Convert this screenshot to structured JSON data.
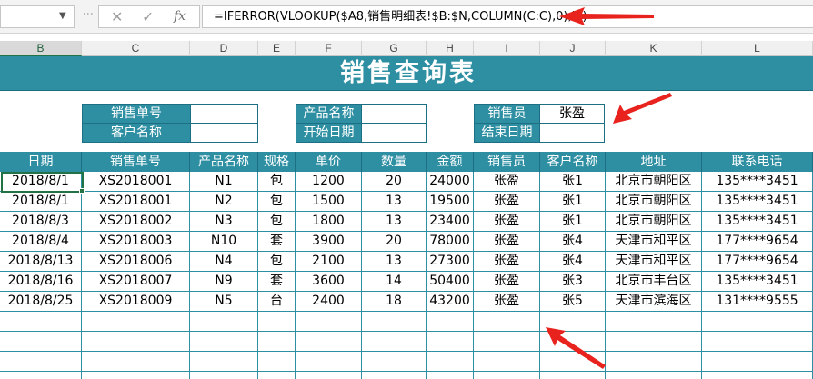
{
  "formula_bar": {
    "name_box": "",
    "cancel_symbol": "✕",
    "confirm_symbol": "✓",
    "fx_symbol": "fx",
    "formula": "=IFERROR(VLOOKUP($A8,销售明细表!$B:$N,COLUMN(C:C),0),\"\")"
  },
  "column_headers": [
    "B",
    "C",
    "D",
    "E",
    "F",
    "G",
    "H",
    "I",
    "J",
    "K",
    "L"
  ],
  "selected_column": "B",
  "title": "销售查询表",
  "query": {
    "order_no_label": "销售单号",
    "order_no_value": "",
    "customer_label": "客户名称",
    "customer_value": "",
    "product_label": "产品名称",
    "product_value": "",
    "start_date_label": "开始日期",
    "start_date_value": "",
    "salesperson_label": "销售员",
    "salesperson_value": "张盈",
    "end_date_label": "结束日期",
    "end_date_value": ""
  },
  "table": {
    "headers": [
      "日期",
      "销售单号",
      "产品名称",
      "规格",
      "单价",
      "数量",
      "金额",
      "销售员",
      "客户名称",
      "地址",
      "联系电话"
    ],
    "rows": [
      [
        "2018/8/1",
        "XS2018001",
        "N1",
        "包",
        "1200",
        "20",
        "24000",
        "张盈",
        "张1",
        "北京市朝阳区",
        "135****3451"
      ],
      [
        "2018/8/1",
        "XS2018001",
        "N2",
        "包",
        "1500",
        "13",
        "19500",
        "张盈",
        "张1",
        "北京市朝阳区",
        "135****3451"
      ],
      [
        "2018/8/3",
        "XS2018002",
        "N3",
        "包",
        "1800",
        "13",
        "23400",
        "张盈",
        "张1",
        "北京市朝阳区",
        "135****3451"
      ],
      [
        "2018/8/4",
        "XS2018003",
        "N10",
        "套",
        "3900",
        "20",
        "78000",
        "张盈",
        "张4",
        "天津市和平区",
        "177****9654"
      ],
      [
        "2018/8/13",
        "XS2018006",
        "N4",
        "包",
        "2100",
        "13",
        "27300",
        "张盈",
        "张4",
        "天津市和平区",
        "177****9654"
      ],
      [
        "2018/8/16",
        "XS2018007",
        "N9",
        "套",
        "3600",
        "14",
        "50400",
        "张盈",
        "张3",
        "北京市丰台区",
        "135****3451"
      ],
      [
        "2018/8/25",
        "XS2018009",
        "N5",
        "台",
        "2400",
        "18",
        "43200",
        "张盈",
        "张5",
        "天津市滨海区",
        "131****9555"
      ]
    ],
    "empty_rows": 4
  },
  "colors": {
    "header_teal": "#2e8fa3",
    "arrow_red": "#e8231e",
    "excel_green": "#217346"
  }
}
